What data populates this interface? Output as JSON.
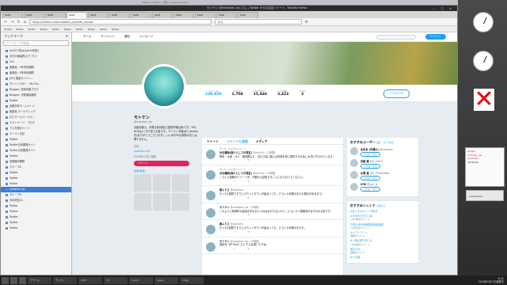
{
  "window": {
    "title": "モトケン (@motoken_tw) さん | Twitter からの注目ツイート - Mozilla Firefox",
    "chrome_title": "Twitter | Twitter | 保存 | Google Chrome"
  },
  "tabs": [
    "Twitt",
    "Twitt",
    "Twitt",
    "Twitt",
    "Twitt",
    "Twitt",
    "Twitt",
    "Twitt",
    "Twitt",
    "Twitt",
    "Twitt",
    "Twitt"
  ],
  "url": "https://twitter.com/motoken_tw/with_replies",
  "search_placeholder": "検索",
  "bookmarks": [
    "Twitter",
    "Twitter",
    "Twitter",
    "Twitter",
    "Twitter",
    "Twitter",
    "Twitter",
    "Twitter",
    "Twitter",
    "Twitter"
  ],
  "sidebar": {
    "title": "ブックマーク",
    "search_placeholder": "ブックマークを検索",
    "items": [
      "kk2017年[projects形態]",
      "今日の番組表[カテゴリ]",
      "2ch",
      "医薬品・5年有効期限",
      "医薬品・5年有効期限",
      "[NT] 国産ガソリン...",
      "ダンシングポー - My Pro...",
      "Blogger: 技術情報ブログ",
      "Blogger: 法務通達管理",
      "Twitter",
      "京都共有ホームページ",
      "医薬品 マーケティング",
      "[IT] ホームページの...",
      "テストページ - ブログ",
      "アスタ株式ページ",
      "ラーメン日記",
      "Twitter",
      "Twitter日系開発サイト",
      "Twitter日系開発サイト",
      "Twitter",
      "長期案内開発",
      "グループA",
      "Twitter",
      "Twitter",
      "Twitter",
      "motoken_tw",
      "グループB",
      "中年男性の...",
      "Twitter",
      "Twitter",
      "Twitter",
      "Twitter",
      "Twitter"
    ]
  },
  "twitter": {
    "nav": [
      "ホーム",
      "モーメント",
      "通知",
      "メッセージ"
    ],
    "tweet_button": "ツイート",
    "stats": [
      {
        "label": "ツイート",
        "value": "139,829"
      },
      {
        "label": "フォロー",
        "value": "1,708"
      },
      {
        "label": "フォロワー",
        "value": "15,446"
      },
      {
        "label": "いいね",
        "value": "3,423"
      },
      {
        "label": "リスト",
        "value": "2"
      }
    ],
    "follow_button": "フォロー中",
    "profile": {
      "name": "モトケン",
      "screen": "@motoken_tw",
      "bio": "元被弁護士、お喋る多弁護士(宮前市場出身)です。YES、NOをはっきり言う主義です。アイコン:作者はY_Gerpho氏(ありがとうございます)。いいねやRTは賛同の意とは限りません。",
      "loc": "日本",
      "link": "motoken.net",
      "joined": "2009年12月に登録",
      "tweet_btn": "ツイート",
      "photos": "画像/動画"
    },
    "feed_tabs": [
      "ツイート",
      "ツイートと返信",
      "メディア"
    ],
    "tweets": [
      {
        "ctx": "モトケンさんがリツイート",
        "name": "大石橋雨(個人としての発言)",
        "handle": "@oishi10 · 13時間",
        "body": "電気・水道・ガス・通信網など、当たり前に使える状態を常に提供するために大切に守られています。",
        "acts": "♡ ⟲ ♥"
      },
      {
        "ctx": "モトケンさんがリツイート",
        "name": "大石橋雨(個人としての発言)",
        "handle": "@oishi10 · 13時間",
        "body": "こういう投稿がツイートが、不要なら拡散することにならないでください。",
        "acts": "♡ ⟲ ♥"
      },
      {
        "ctx": "",
        "name": "春ふりさ",
        "handle": "@Aoyama",
        "body": "たった2週間ですでにカウントダウンが始まっても、どういう状態の方から検討があるので。",
        "acts": "♡ ⟲ ♥"
      },
      {
        "ctx": "",
        "name": "モトケン",
        "handle": "@motoken_tw · 22時間",
        "body": "このように精神的な負担があるかどうかは分からないので、どういう人間関係がまず分かる事です。",
        "acts": "♡ ⟲ ♥"
      },
      {
        "ctx": "",
        "name": "春ふりさ",
        "handle": "@Aoyama",
        "body": "たった2週間ですでにカウントダウンが始まっても、どういう状態の方から。",
        "acts": "♡ ⟲ ♥"
      },
      {
        "ctx": "",
        "name": "モトケン",
        "handle": "@motoken_tw · 22時間",
        "body": "返信先: @T0042 さん そんな感じですね。",
        "acts": "♡ ⟲ ♥"
      }
    ],
    "who_to_follow": {
      "title": "おすすめユーザー",
      "refresh": "更新 · すべて表示",
      "users": [
        {
          "name": "あああ (弁護士)",
          "handle": "@masashi",
          "btn": "フォローする"
        },
        {
          "name": "京極 理",
          "handle": "@A_SAITO",
          "btn": "フォローする"
        },
        {
          "name": "水澤 遥",
          "handle": "@R_TERASAWA",
          "btn": "フォローする"
        },
        {
          "name": "VPK",
          "handle": "@vpk_jp",
          "btn": "フォローする"
        }
      ]
    },
    "trends": {
      "title": "おすすめトレンド",
      "change": "変更する",
      "items": [
        {
          "name": "#余ったカロリーの所存",
          "count": ""
        },
        {
          "name": "#今日の打ちたいぬ",
          "count": "1,234件のツイート"
        },
        {
          "name": "平成30年北海道胆振東部地震",
          "count": "1.2万件のツイート"
        },
        {
          "name": "セイコーマート",
          "count": "話題のツイート"
        },
        {
          "name": "#一般企業で何した",
          "count": "1,452件のツイート"
        },
        {
          "name": "防災の日",
          "count": "話題のツイート"
        },
        {
          "name": "#つけ麺",
          "count": ""
        }
      ]
    }
  },
  "desktop": {
    "notes": [
      "Twitter",
      "motoken_tw",
      "sp.2018s",
      "2018/9/6"
    ],
    "screenshot": "screenShot"
  },
  "taskbar": {
    "items": [
      "アラーム",
      "モトケン",
      "2017",
      "Tk",
      "xclock",
      "xeyes",
      "xlogo"
    ],
    "clock": "6:41",
    "date": "2018年9月7日金曜日"
  }
}
